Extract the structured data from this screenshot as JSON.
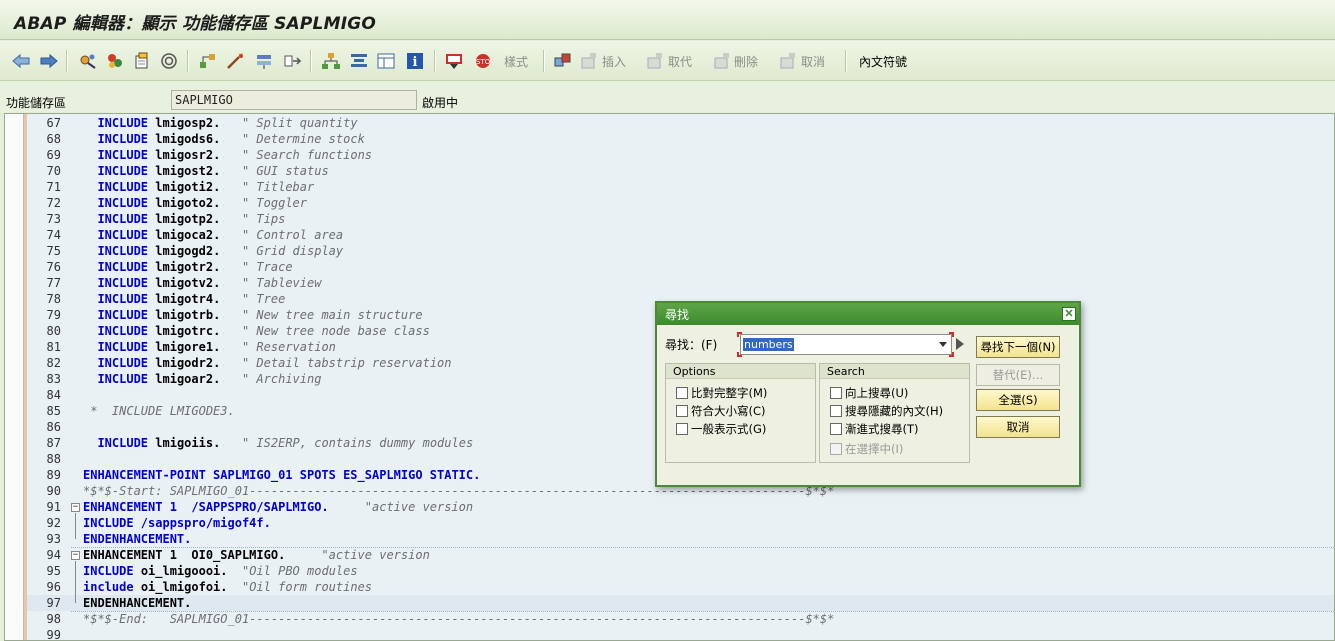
{
  "window": {
    "title": "ABAP 編輯器：顯示 功能儲存區 SAPLMIGO"
  },
  "toolbar": {
    "icons": [
      "back-arrow-icon",
      "forward-arrow-icon",
      "other-object-icon",
      "display-change-icon",
      "active-inactive-icon",
      "where-used-icon",
      "object-list-icon",
      "pretty-printer-icon",
      "check-icon",
      "activate-icon",
      "test-icon",
      "navigate-icon",
      "hierarchy-icon",
      "outline-icon",
      "info-icon",
      "pattern-icon",
      "mark-icon"
    ],
    "style_label": "樣式",
    "insert_label": "插入",
    "replace_label": "取代",
    "delete_label": "刪除",
    "undo_label": "取消",
    "inline_label": "內文符號"
  },
  "module": {
    "label": "功能儲存區",
    "value": "SAPLMIGO",
    "status": "啟用中"
  },
  "editor": {
    "lines": [
      {
        "n": "67",
        "kw": "INCLUDE",
        "id": "lmigosp2.",
        "cm": "\" Split quantity"
      },
      {
        "n": "68",
        "kw": "INCLUDE",
        "id": "lmigods6.",
        "cm": "\" Determine stock"
      },
      {
        "n": "69",
        "kw": "INCLUDE",
        "id": "lmigosr2.",
        "cm": "\" Search functions"
      },
      {
        "n": "70",
        "kw": "INCLUDE",
        "id": "lmigost2.",
        "cm": "\" GUI status"
      },
      {
        "n": "71",
        "kw": "INCLUDE",
        "id": "lmigoti2.",
        "cm": "\" Titlebar"
      },
      {
        "n": "72",
        "kw": "INCLUDE",
        "id": "lmigoto2.",
        "cm": "\" Toggler"
      },
      {
        "n": "73",
        "kw": "INCLUDE",
        "id": "lmigotp2.",
        "cm": "\" Tips"
      },
      {
        "n": "74",
        "kw": "INCLUDE",
        "id": "lmigoca2.",
        "cm": "\" Control area"
      },
      {
        "n": "75",
        "kw": "INCLUDE",
        "id": "lmigogd2.",
        "cm": "\" Grid display"
      },
      {
        "n": "76",
        "kw": "INCLUDE",
        "id": "lmigotr2.",
        "cm": "\" Trace"
      },
      {
        "n": "77",
        "kw": "INCLUDE",
        "id": "lmigotv2.",
        "cm": "\" Tableview"
      },
      {
        "n": "78",
        "kw": "INCLUDE",
        "id": "lmigotr4.",
        "cm": "\" Tree"
      },
      {
        "n": "79",
        "kw": "INCLUDE",
        "id": "lmigotrb.",
        "cm": "\" New tree main structure"
      },
      {
        "n": "80",
        "kw": "INCLUDE",
        "id": "lmigotrc.",
        "cm": "\" New tree node base class"
      },
      {
        "n": "81",
        "kw": "INCLUDE",
        "id": "lmigore1.",
        "cm": "\" Reservation"
      },
      {
        "n": "82",
        "kw": "INCLUDE",
        "id": "lmigodr2.",
        "cm": "\" Detail tabstrip reservation"
      },
      {
        "n": "83",
        "kw": "INCLUDE",
        "id": "lmigoar2.",
        "cm": "\" Archiving"
      },
      {
        "n": "84"
      },
      {
        "n": "85",
        "cmline": "*  INCLUDE LMIGODE3."
      },
      {
        "n": "86"
      },
      {
        "n": "87",
        "kw": "INCLUDE",
        "id": "lmigoiis.",
        "cm": "\" IS2ERP, contains dummy modules"
      },
      {
        "n": "88"
      },
      {
        "n": "89",
        "raw": "ENHANCEMENT-POINT SAPLMIGO_01 SPOTS ES_SAPLMIGO STATIC."
      },
      {
        "n": "90",
        "cmline": "*$*$-Start: SAPLMIGO_01-----------------------------------------------------------------------------$*$*"
      },
      {
        "n": "91",
        "raw": "ENHANCEMENT 1  /SAPPSPRO/SAPLMIGO.",
        "cm": "\"active version"
      },
      {
        "n": "92",
        "raw": "INCLUDE /sappspro/migof4f."
      },
      {
        "n": "93",
        "raw": "ENDENHANCEMENT."
      },
      {
        "n": "94",
        "raw": "ENHANCEMENT 1  OI0_SAPLMIGO.",
        "cm": "\"active version"
      },
      {
        "n": "95",
        "kw": "INCLUDE",
        "id": "oi_lmigoooi.",
        "cm": "\"Oil PBO modules"
      },
      {
        "n": "96",
        "kw": "include",
        "id": "oi_lmigofoi.",
        "cm": "\"Oil form routines"
      },
      {
        "n": "97",
        "raw": "ENDENHANCEMENT."
      },
      {
        "n": "98",
        "cmline": "*$*$-End:   SAPLMIGO_01-----------------------------------------------------------------------------$*$*"
      },
      {
        "n": "99"
      }
    ]
  },
  "find_dialog": {
    "title": "尋找",
    "find_label": "尋找：(F)",
    "find_value": "numbers",
    "options_header": "Options",
    "options": [
      "比對完整字(M)",
      "符合大小寫(C)",
      "一般表示式(G)"
    ],
    "search_header": "Search",
    "search_options": [
      "向上搜尋(U)",
      "搜尋隱藏的內文(H)",
      "漸進式搜尋(T)",
      "在選擇中(I)"
    ],
    "btn_find_next": "尋找下一個(N)",
    "btn_replace": "替代(E)…",
    "btn_select_all": "全選(S)",
    "btn_cancel": "取消"
  }
}
